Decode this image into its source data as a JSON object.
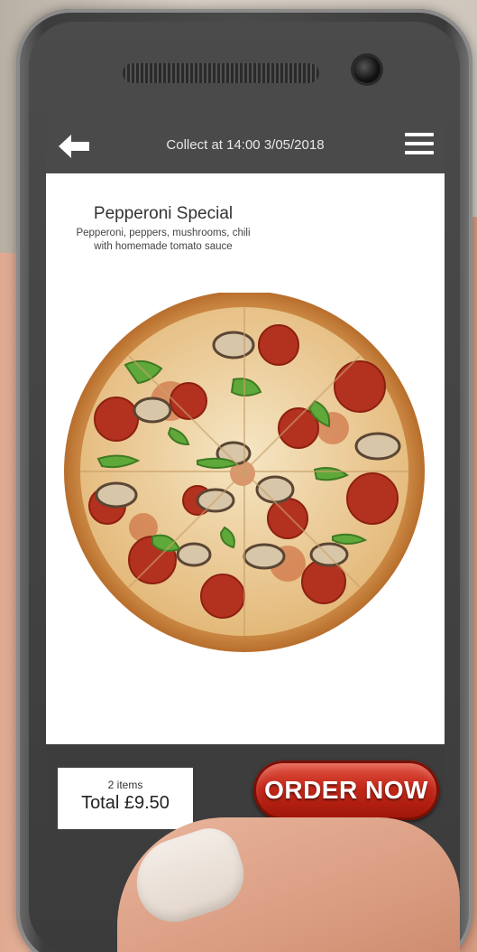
{
  "header": {
    "title": "Collect at 14:00 3/05/2018",
    "back_icon": "arrow-left-icon",
    "menu_icon": "hamburger-menu-icon"
  },
  "product": {
    "name": "Pepperoni Special",
    "description_line1": "Pepperoni, peppers, mushrooms, chili",
    "description_line2": "with homemade tomato sauce"
  },
  "cart": {
    "item_count": "2 items",
    "total": "Total £9.50"
  },
  "order_button": {
    "label": "ORDER NOW",
    "color": "#c4281a"
  },
  "colors": {
    "header_bg": "#4a4a4a",
    "bottom_bar_bg": "#3d3d3d"
  }
}
